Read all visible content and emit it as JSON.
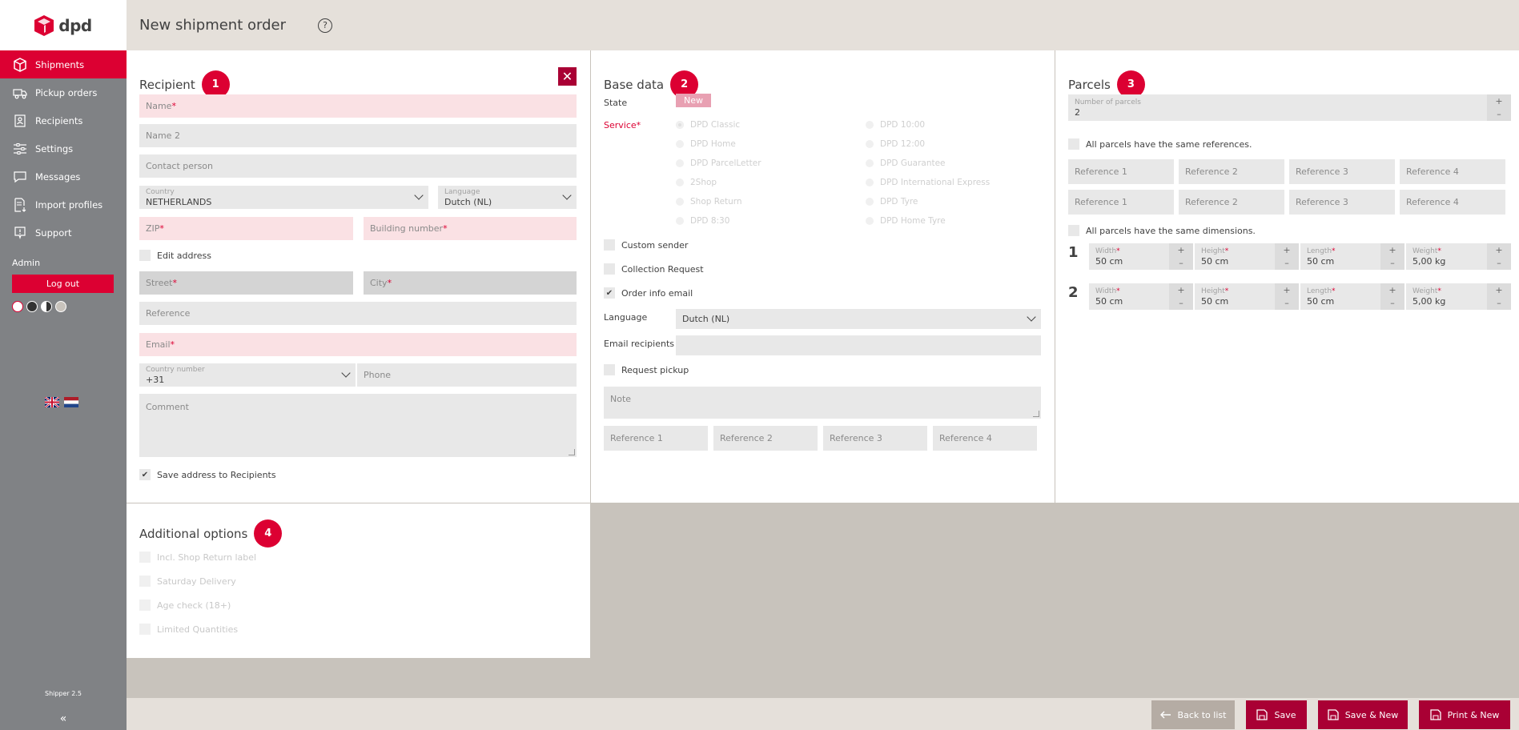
{
  "app": {
    "logo_text": "dpd"
  },
  "sidebar": {
    "items": [
      {
        "label": "Shipments",
        "icon": "box-icon"
      },
      {
        "label": "Pickup orders",
        "icon": "truck-icon"
      },
      {
        "label": "Recipients",
        "icon": "contact-icon"
      },
      {
        "label": "Settings",
        "icon": "sliders-icon"
      },
      {
        "label": "Messages",
        "icon": "message-icon"
      },
      {
        "label": "Import profiles",
        "icon": "import-icon"
      },
      {
        "label": "Support",
        "icon": "support-icon"
      }
    ],
    "admin_label": "Admin",
    "logout_label": "Log out",
    "version": "Shipper 2.5",
    "collapse_glyph": "«"
  },
  "header": {
    "title": "New shipment order",
    "help_glyph": "?"
  },
  "recipient": {
    "title": "Recipient",
    "badge": "1",
    "close_glyph": "✕",
    "name": "Name",
    "name2": "Name 2",
    "contact": "Contact person",
    "country_label": "Country",
    "country_value": "NETHERLANDS",
    "language_label": "Language",
    "language_value": "Dutch (NL)",
    "zip": "ZIP",
    "building": "Building number",
    "edit_address": "Edit address",
    "street": "Street",
    "city": "City",
    "reference": "Reference",
    "email": "Email",
    "country_number_label": "Country number",
    "country_number_value": "+31",
    "phone": "Phone",
    "comment": "Comment",
    "save_address": "Save address to Recipients",
    "required_mark": "*"
  },
  "base": {
    "title": "Base data",
    "badge": "2",
    "state_label": "State",
    "state_value": "New",
    "service_label": "Service",
    "services_left": [
      "DPD Classic",
      "DPD Home",
      "DPD ParcelLetter",
      "2Shop",
      "Shop Return",
      "DPD 8:30"
    ],
    "services_right": [
      "DPD 10:00",
      "DPD 12:00",
      "DPD Guarantee",
      "DPD International Express",
      "DPD Tyre",
      "DPD Home Tyre"
    ],
    "custom_sender": "Custom sender",
    "collection_request": "Collection Request",
    "order_info_email": "Order info email",
    "language_label": "Language",
    "language_value": "Dutch (NL)",
    "email_recipients_label": "Email recipients",
    "request_pickup": "Request pickup",
    "note": "Note",
    "references": [
      "Reference 1",
      "Reference 2",
      "Reference 3",
      "Reference 4"
    ]
  },
  "parcels": {
    "title": "Parcels",
    "badge": "3",
    "number_label": "Number of parcels",
    "number_value": "2",
    "same_refs": "All parcels have the same references.",
    "ref_rows": [
      [
        "Reference 1",
        "Reference 2",
        "Reference 3",
        "Reference 4"
      ],
      [
        "Reference 1",
        "Reference 2",
        "Reference 3",
        "Reference 4"
      ]
    ],
    "same_dims": "All parcels have the same dimensions.",
    "rows": [
      {
        "no": "1",
        "width": "50 cm",
        "height": "50 cm",
        "length": "50 cm",
        "weight": "5,00 kg"
      },
      {
        "no": "2",
        "width": "50 cm",
        "height": "50 cm",
        "length": "50 cm",
        "weight": "5,00 kg"
      }
    ],
    "dim_labels": {
      "width": "Width",
      "height": "Height",
      "length": "Length",
      "weight": "Weight"
    },
    "plus": "+",
    "minus": "–"
  },
  "options": {
    "title": "Additional options",
    "badge": "4",
    "items": [
      "Incl. Shop Return label",
      "Saturday Delivery",
      "Age check (18+)",
      "Limited Quantities"
    ]
  },
  "footer": {
    "back": "Back to list",
    "save": "Save",
    "save_new": "Save & New",
    "print_new": "Print & New"
  },
  "colors": {
    "brand": "#dc0032",
    "brand_dark": "#a90034",
    "sidebar": "#808285"
  }
}
